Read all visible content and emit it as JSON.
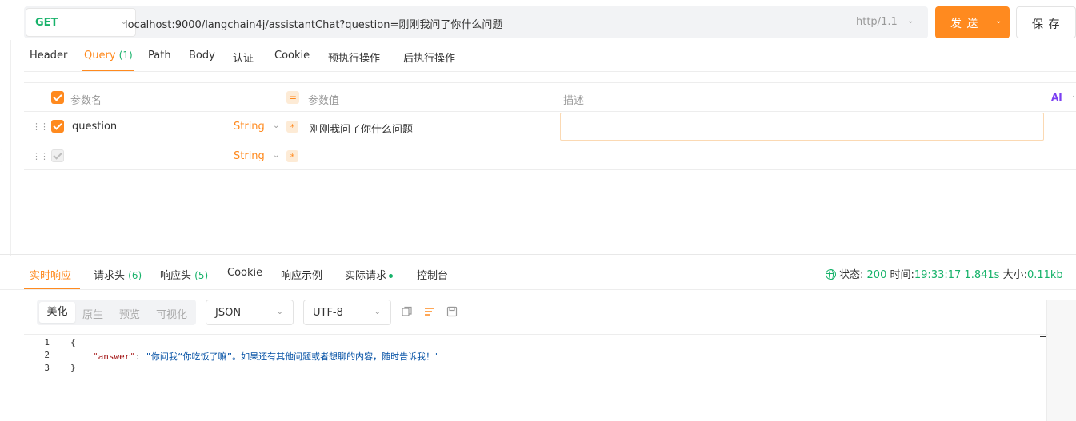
{
  "request": {
    "method": "GET",
    "url": "localhost:9000/langchain4j/assistantChat?question=刚刚我问了你什么问题",
    "protocol": "http/1.1",
    "send_label": "发 送",
    "save_label": "保 存"
  },
  "request_tabs": [
    {
      "label": "Header"
    },
    {
      "label": "Query",
      "count": "(1)"
    },
    {
      "label": "Path"
    },
    {
      "label": "Body"
    },
    {
      "label": "认证"
    },
    {
      "label": "Cookie"
    },
    {
      "label": "预执行操作"
    },
    {
      "label": "后执行操作"
    }
  ],
  "params": {
    "headers": {
      "name": "参数名",
      "value": "参数值",
      "desc": "描述",
      "ai": "AI"
    },
    "rows": [
      {
        "name": "question",
        "type": "String",
        "value": "刚刚我问了你什么问题",
        "checked": true
      },
      {
        "name": "",
        "type": "String",
        "value": "",
        "checked": false
      }
    ]
  },
  "response_tabs": [
    {
      "label": "实时响应"
    },
    {
      "label": "请求头",
      "count": "(6)"
    },
    {
      "label": "响应头",
      "count": "(5)"
    },
    {
      "label": "Cookie"
    },
    {
      "label": "响应示例"
    },
    {
      "label": "实际请求"
    },
    {
      "label": "控制台"
    }
  ],
  "status": {
    "label": "状态:",
    "code": "200",
    "time_label": "时间:",
    "time": "19:33:17",
    "duration": "1.841s",
    "size_label": "大小:",
    "size": "0.11kb"
  },
  "viewer": {
    "modes": [
      "美化",
      "原生",
      "预览",
      "可视化"
    ],
    "format": "JSON",
    "encoding": "UTF-8"
  },
  "code": {
    "line_numbers": [
      "1",
      "2",
      "3"
    ],
    "open_brace": "{",
    "key": "\"answer\"",
    "colon": ": ",
    "value": "\"你问我“你吃饭了嘛”。如果还有其他问题或者想聊的内容，随时告诉我！\"",
    "close_brace": "}"
  },
  "colors": {
    "accent": "#ff8a1f",
    "success": "#17b26a",
    "ai": "#7b3ff2"
  }
}
